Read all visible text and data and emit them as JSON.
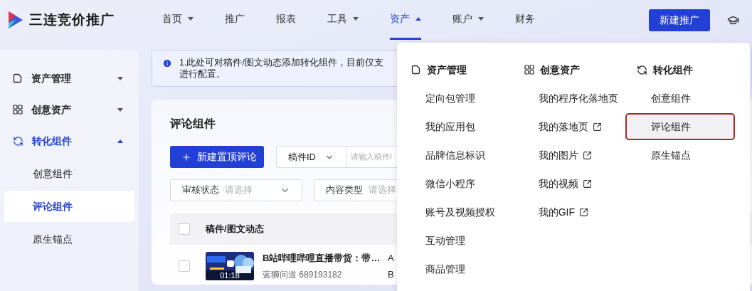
{
  "brand": {
    "name": "三连竞价推广"
  },
  "nav": [
    {
      "label": "首页",
      "has_caret": true,
      "selected": false
    },
    {
      "label": "推广",
      "has_caret": false,
      "selected": false
    },
    {
      "label": "报表",
      "has_caret": false,
      "selected": false
    },
    {
      "label": "工具",
      "has_caret": true,
      "selected": false
    },
    {
      "label": "资产",
      "has_caret": true,
      "selected": true
    },
    {
      "label": "账户",
      "has_caret": true,
      "selected": false
    },
    {
      "label": "财务",
      "has_caret": false,
      "selected": false
    }
  ],
  "primary_button": "新建推广",
  "sidebar": {
    "items": [
      {
        "label": "资产管理",
        "expanded": false
      },
      {
        "label": "创意资产",
        "expanded": false
      },
      {
        "label": "转化组件",
        "expanded": true,
        "children": [
          {
            "label": "创意组件",
            "selected": false
          },
          {
            "label": "评论组件",
            "selected": true
          },
          {
            "label": "原生锚点",
            "selected": false
          }
        ]
      }
    ]
  },
  "alert": {
    "lines": [
      "1.此处可对稿件/图文动态添加转化组件，目前仅支",
      "进行配置。"
    ]
  },
  "card": {
    "title": "评论组件",
    "create_button": "新建置顶评论",
    "id_select": "稿件ID",
    "id_search": {
      "placeholder": "请输入稿件I"
    },
    "filters": [
      {
        "label": "审核状态",
        "placeholder": "请选择"
      },
      {
        "label": "内容类型",
        "placeholder": "请选择"
      }
    ],
    "table": {
      "columns": [
        "稿件/图文动态"
      ],
      "header_checked": false,
      "rows": [
        {
          "checked": false,
          "title": "B站哔哩哔哩直播带货：带…",
          "subtitle": "蓝狮问道 689193182",
          "duration": "01:18",
          "column_2": [
            "A",
            "B"
          ]
        }
      ]
    }
  },
  "menu": {
    "columns": [
      {
        "title": "资产管理",
        "items": [
          {
            "label": "定向包管理",
            "external": false,
            "selected": false
          },
          {
            "label": "我的应用包",
            "external": false,
            "selected": false
          },
          {
            "label": "品牌信息标识",
            "external": false,
            "selected": false
          },
          {
            "label": "微信小程序",
            "external": false,
            "selected": false
          },
          {
            "label": "账号及视频授权",
            "external": false,
            "selected": false
          },
          {
            "label": "互动管理",
            "external": false,
            "selected": false
          },
          {
            "label": "商品管理",
            "external": false,
            "selected": false
          }
        ]
      },
      {
        "title": "创意资产",
        "items": [
          {
            "label": "我的程序化落地页",
            "external": false,
            "selected": false
          },
          {
            "label": "我的落地页",
            "external": true,
            "selected": false
          },
          {
            "label": "我的图片",
            "external": true,
            "selected": false
          },
          {
            "label": "我的视频",
            "external": true,
            "selected": false
          },
          {
            "label": "我的GIF",
            "external": true,
            "selected": false
          }
        ]
      },
      {
        "title": "转化组件",
        "items": [
          {
            "label": "创意组件",
            "external": false,
            "selected": false
          },
          {
            "label": "评论组件",
            "external": false,
            "selected": true
          },
          {
            "label": "原生锚点",
            "external": false,
            "selected": false
          }
        ]
      }
    ]
  }
}
